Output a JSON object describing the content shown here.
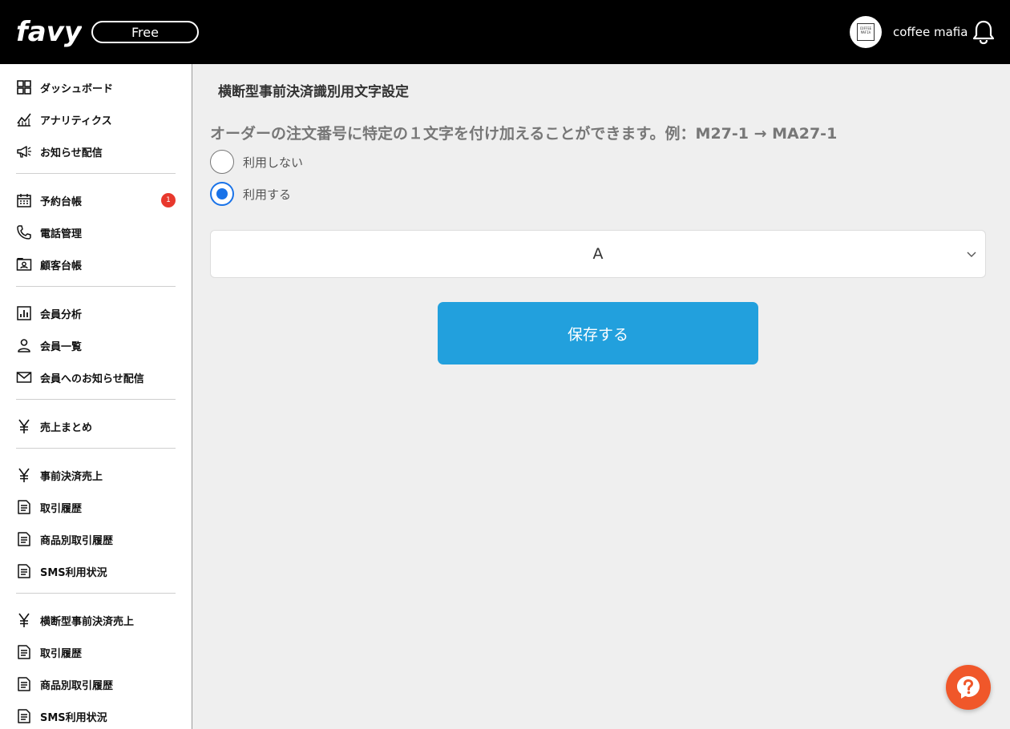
{
  "header": {
    "logo_text": "favy",
    "plan_label": "Free",
    "avatar_text": "COFFEE MAFIA",
    "shop_name": "coffee mafia"
  },
  "sidebar": {
    "groups": [
      [
        {
          "label": "ダッシュボード",
          "icon": "grid-icon"
        },
        {
          "label": "アナリティクス",
          "icon": "chart-line-icon"
        },
        {
          "label": "お知らせ配信",
          "icon": "megaphone-icon"
        }
      ],
      [
        {
          "label": "予約台帳",
          "icon": "calendar-icon",
          "badge": "1"
        },
        {
          "label": "電話管理",
          "icon": "phone-icon"
        },
        {
          "label": "顧客台帳",
          "icon": "contact-card-icon"
        }
      ],
      [
        {
          "label": "会員分析",
          "icon": "bar-chart-icon"
        },
        {
          "label": "会員一覧",
          "icon": "person-icon"
        },
        {
          "label": "会員へのお知らせ配信",
          "icon": "mail-icon"
        }
      ],
      [
        {
          "label": "売上まとめ",
          "icon": "yen-icon"
        }
      ],
      [
        {
          "label": "事前決済売上",
          "icon": "yen-icon"
        },
        {
          "label": "取引履歴",
          "icon": "document-icon"
        },
        {
          "label": "商品別取引履歴",
          "icon": "document-icon"
        },
        {
          "label": "SMS利用状況",
          "icon": "document-icon"
        }
      ],
      [
        {
          "label": "横断型事前決済売上",
          "icon": "yen-icon"
        },
        {
          "label": "取引履歴",
          "icon": "document-icon"
        },
        {
          "label": "商品別取引履歴",
          "icon": "document-icon"
        },
        {
          "label": "SMS利用状況",
          "icon": "document-icon"
        }
      ]
    ]
  },
  "main": {
    "title": "横断型事前決済識別用文字設定",
    "description": "オーダーの注文番号に特定の１文字を付け加えることができます。例：M27-1 → MA27-1",
    "options": [
      {
        "label": "利用しない",
        "checked": false
      },
      {
        "label": "利用する",
        "checked": true
      }
    ],
    "select_value": "A",
    "save_label": "保存する"
  },
  "colors": {
    "topbar": "#000000",
    "primary_button": "#22a0dd",
    "radio_selected": "#1a73e8",
    "badge": "#e8382d",
    "help_button": "#f0572a"
  }
}
